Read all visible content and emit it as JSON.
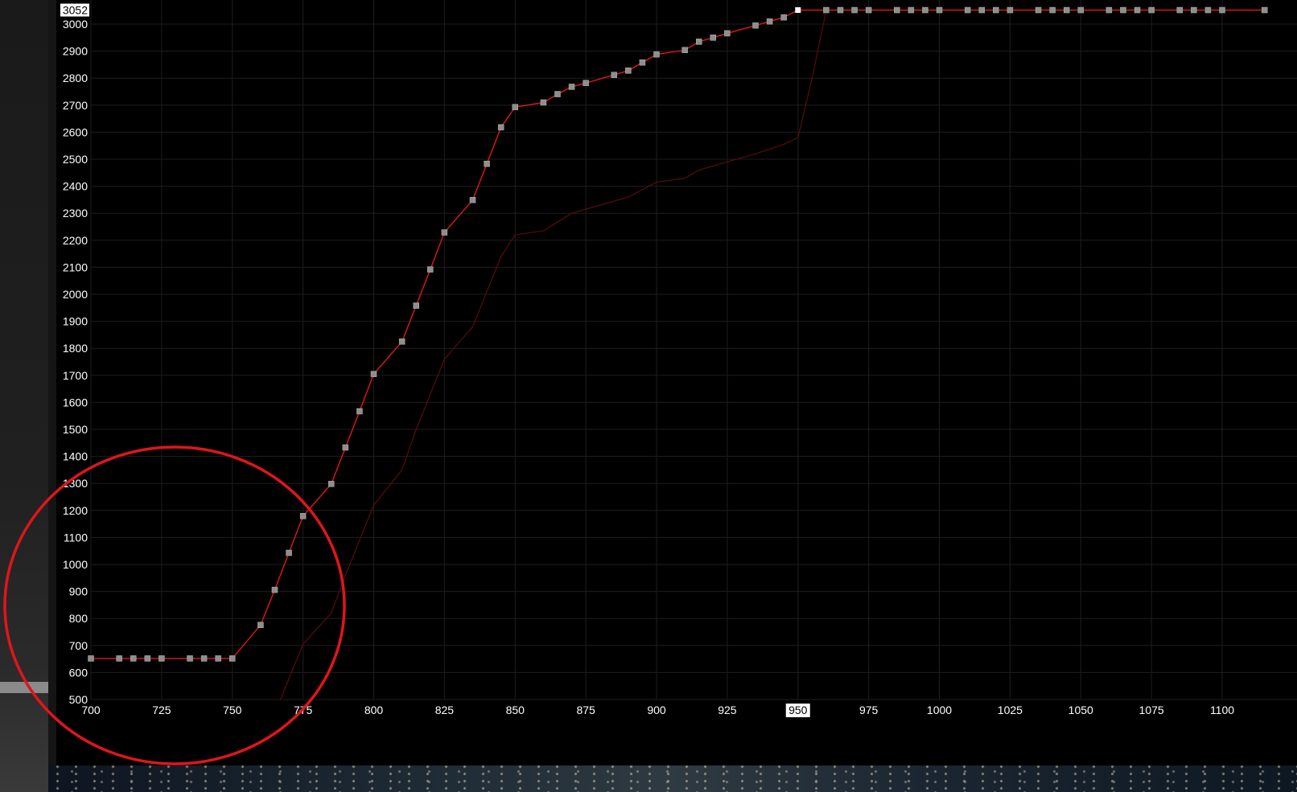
{
  "chart_data": {
    "type": "line",
    "title": "",
    "xlabel": "",
    "ylabel": "",
    "xlim": [
      700,
      1115
    ],
    "ylim": [
      500,
      3052
    ],
    "x_ticks": [
      700,
      725,
      750,
      775,
      800,
      825,
      850,
      875,
      900,
      925,
      950,
      975,
      1000,
      1025,
      1050,
      1075,
      1100
    ],
    "y_ticks": [
      500,
      600,
      700,
      800,
      900,
      1000,
      1100,
      1200,
      1300,
      1400,
      1500,
      1600,
      1700,
      1800,
      1900,
      2000,
      2100,
      2200,
      2300,
      2400,
      2500,
      2600,
      2700,
      2800,
      2900,
      3000
    ],
    "grid": true,
    "crosshair": {
      "x_label": "950",
      "y_label": "3052"
    },
    "series": [
      {
        "role": "main",
        "color": "#e01818",
        "markers": true,
        "x": [
          700,
          710,
          715,
          720,
          725,
          735,
          740,
          745,
          750,
          760,
          765,
          770,
          775,
          785,
          790,
          795,
          800,
          810,
          815,
          820,
          825,
          835,
          840,
          845,
          850,
          860,
          865,
          870,
          875,
          885,
          890,
          895,
          900,
          910,
          915,
          920,
          925,
          935,
          940,
          945,
          950,
          960,
          965,
          970,
          975,
          985,
          990,
          995,
          1000,
          1010,
          1015,
          1020,
          1025,
          1035,
          1040,
          1045,
          1050,
          1060,
          1065,
          1070,
          1075,
          1085,
          1090,
          1095,
          1100,
          1115
        ],
        "y": [
          652,
          652,
          652,
          652,
          652,
          652,
          652,
          652,
          652,
          776,
          906,
          1043,
          1179,
          1298,
          1433,
          1567,
          1705,
          1825,
          1958,
          2092,
          2229,
          2349,
          2483,
          2618,
          2693,
          2710,
          2741,
          2768,
          2782,
          2812,
          2828,
          2858,
          2888,
          2904,
          2935,
          2950,
          2966,
          2995,
          3010,
          3025,
          3052,
          3052,
          3052,
          3052,
          3052,
          3052,
          3052,
          3052,
          3052,
          3052,
          3052,
          3052,
          3052,
          3052,
          3052,
          3052,
          3052,
          3052,
          3052,
          3052,
          3052,
          3052,
          3052,
          3052,
          3052,
          3052
        ]
      },
      {
        "role": "reference",
        "color": "#5a0c0c",
        "markers": false,
        "x": [
          767,
          775,
          785,
          790,
          800,
          810,
          815,
          825,
          835,
          845,
          850,
          860,
          870,
          880,
          890,
          900,
          910,
          915,
          925,
          935,
          945,
          950,
          955,
          960,
          1115
        ],
        "y": [
          500,
          705,
          820,
          960,
          1220,
          1350,
          1500,
          1760,
          1880,
          2140,
          2220,
          2235,
          2300,
          2330,
          2360,
          2415,
          2430,
          2460,
          2490,
          2520,
          2555,
          2580,
          2800,
          3052,
          3052
        ]
      }
    ],
    "annotation": {
      "shape": "circle",
      "color": "#e0151b"
    }
  }
}
